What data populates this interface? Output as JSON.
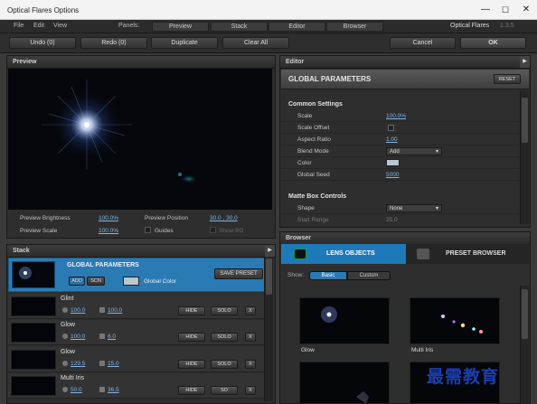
{
  "window": {
    "title": "Optical Flares Options",
    "minimize": "—",
    "maximize": "☐",
    "close": "✕"
  },
  "menu": {
    "file": "File",
    "edit": "Edit",
    "view": "View",
    "panels_label": "Panels:",
    "tabs": [
      "Preview",
      "Stack",
      "Editor",
      "Browser"
    ],
    "brand": "Optical Flares",
    "version": "1.3.5"
  },
  "toolbar": {
    "undo": "Undo (0)",
    "redo": "Redo (0)",
    "duplicate": "Duplicate",
    "clear_all": "Clear All",
    "cancel": "Cancel",
    "ok": "OK"
  },
  "preview": {
    "header": "Preview",
    "brightness_label": "Preview Brightness",
    "brightness_value": "100.0%",
    "position_label": "Preview Position",
    "position_value": "30.0 , 30.0",
    "scale_label": "Preview Scale",
    "scale_value": "100.0%",
    "guides_label": "Guides",
    "showbg_label": "Show BG"
  },
  "stack": {
    "header": "Stack",
    "global": {
      "title": "GLOBAL PARAMETERS",
      "add": "ADD",
      "scn": "SCN",
      "global_color": "Global Color",
      "save_preset": "SAVE PRESET"
    },
    "items": [
      {
        "name": "Glint",
        "v1": "100.0",
        "v2": "100.0",
        "hide": "HIDE",
        "solo": "SOLO",
        "x": "X"
      },
      {
        "name": "Glow",
        "v1": "100.0",
        "v2": "6.0",
        "hide": "HIDE",
        "solo": "SOLO",
        "x": "X"
      },
      {
        "name": "Glow",
        "v1": "129.5",
        "v2": "15.0",
        "hide": "HIDE",
        "solo": "SOLO",
        "x": "X"
      },
      {
        "name": "Multi Iris",
        "v1": "50.0",
        "v2": "36.5",
        "hide": "HIDE",
        "solo": "SO",
        "x": "X"
      }
    ]
  },
  "editor": {
    "header": "Editor",
    "title": "GLOBAL PARAMETERS",
    "reset": "RESET",
    "common_title": "Common Settings",
    "rows": [
      {
        "label": "Scale",
        "value": "100.0%"
      },
      {
        "label": "Scale Offset",
        "value": ""
      },
      {
        "label": "Aspect Ratio",
        "value": "1.00"
      },
      {
        "label": "Blend Mode",
        "value": "Add"
      },
      {
        "label": "Color",
        "value": ""
      },
      {
        "label": "Global Seed",
        "value": "5000"
      }
    ],
    "matte_title": "Matte Box Controls",
    "shape_label": "Shape",
    "shape_value": "None",
    "start_range_label": "Start Range",
    "start_range_value": "25.0"
  },
  "browser": {
    "header": "Browser",
    "lens_objects": "LENS OBJECTS",
    "preset_browser": "PRESET BROWSER",
    "show_label": "Show:",
    "basic": "Basic",
    "custom": "Custom",
    "items": [
      "Glow",
      "Multi Iris"
    ]
  },
  "watermark": "最需教育",
  "colors": {
    "accent": "#2a7ab4",
    "link": "#7fb6e6"
  }
}
